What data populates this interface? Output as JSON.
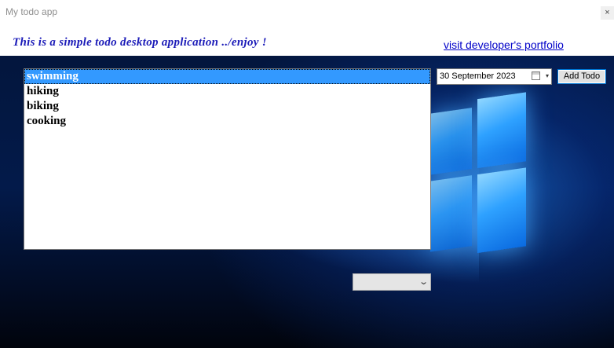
{
  "window": {
    "title": "My todo app",
    "close_glyph": "×"
  },
  "header": {
    "tagline": "This is a simple todo desktop application ../enjoy !",
    "portfolio_link": "visit developer's portfolio"
  },
  "todos": {
    "selected_index": 0,
    "items": [
      {
        "label": "swimming"
      },
      {
        "label": "hiking"
      },
      {
        "label": "biking"
      },
      {
        "label": "cooking"
      }
    ]
  },
  "date_picker": {
    "value": "30 September 2023",
    "icon": "calendar-icon",
    "dropdown_glyph": "▾"
  },
  "add_button": {
    "label": "Add Todo"
  },
  "dropdown": {
    "value": "",
    "chevron_glyph": "⌄"
  },
  "colors": {
    "accent": "#3399ff",
    "link": "#0000c8",
    "tagline": "#1b1bb8",
    "background": "#031a4a"
  }
}
